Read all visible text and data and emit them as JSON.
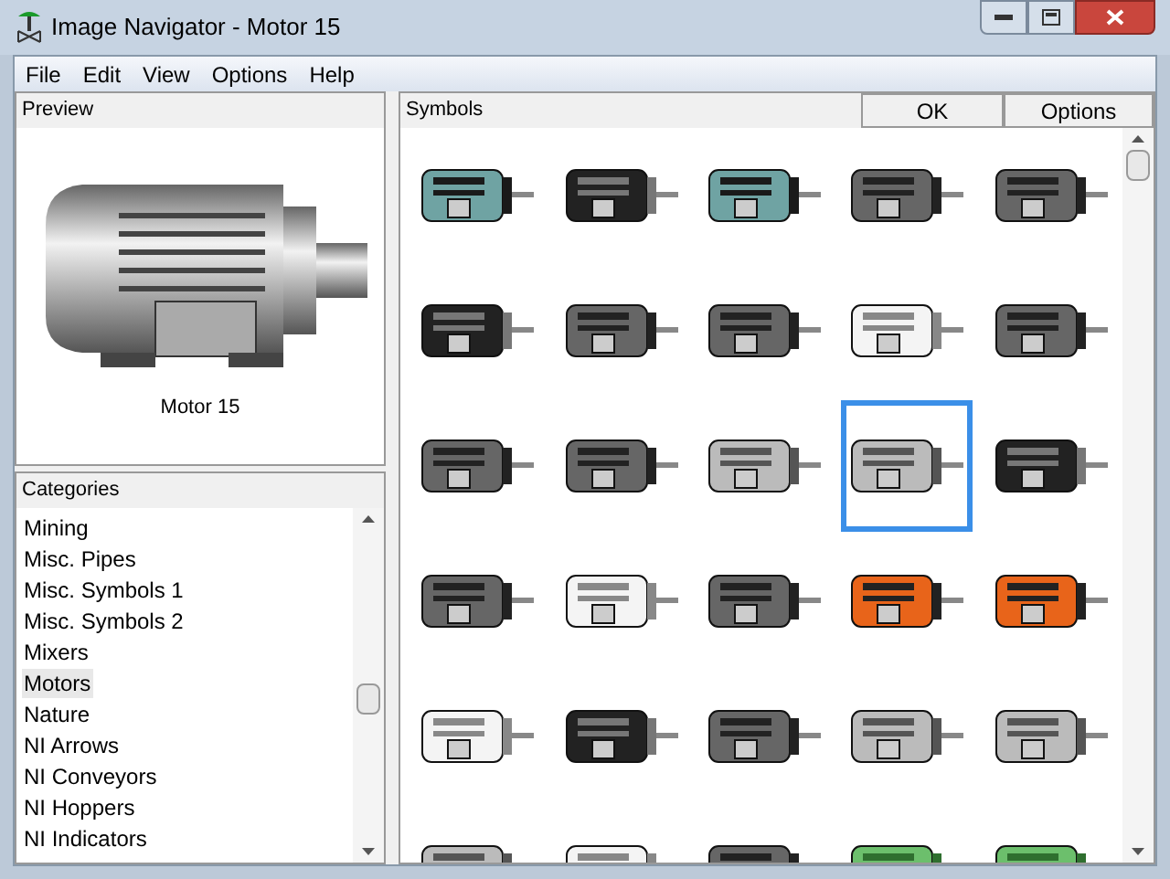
{
  "window": {
    "title": "Image Navigator - Motor 15"
  },
  "menu": [
    "File",
    "Edit",
    "View",
    "Options",
    "Help"
  ],
  "preview": {
    "header": "Preview",
    "caption": "Motor 15"
  },
  "categories": {
    "header": "Categories",
    "items": [
      {
        "label": "Mining",
        "selected": false
      },
      {
        "label": "Misc. Pipes",
        "selected": false
      },
      {
        "label": "Misc. Symbols 1",
        "selected": false
      },
      {
        "label": "Misc. Symbols 2",
        "selected": false
      },
      {
        "label": "Mixers",
        "selected": false
      },
      {
        "label": "Motors",
        "selected": true
      },
      {
        "label": "Nature",
        "selected": false
      },
      {
        "label": "NI Arrows",
        "selected": false
      },
      {
        "label": "NI Conveyors",
        "selected": false
      },
      {
        "label": "NI Hoppers",
        "selected": false
      },
      {
        "label": "NI Indicators",
        "selected": false
      }
    ]
  },
  "symbols": {
    "header": "Symbols",
    "buttons": [
      "OK",
      "Options"
    ],
    "items": [
      {
        "kind": "teal",
        "selected": false
      },
      {
        "kind": "black",
        "selected": false
      },
      {
        "kind": "teal",
        "selected": false
      },
      {
        "kind": "dark",
        "selected": false
      },
      {
        "kind": "dark",
        "selected": false
      },
      {
        "kind": "black",
        "selected": false
      },
      {
        "kind": "dark",
        "selected": false
      },
      {
        "kind": "dark",
        "selected": false
      },
      {
        "kind": "white",
        "selected": false
      },
      {
        "kind": "dark",
        "selected": false
      },
      {
        "kind": "dark",
        "selected": false
      },
      {
        "kind": "dark",
        "selected": false
      },
      {
        "kind": "silver",
        "selected": false
      },
      {
        "kind": "silver",
        "selected": true
      },
      {
        "kind": "black",
        "selected": false
      },
      {
        "kind": "dark",
        "selected": false
      },
      {
        "kind": "white",
        "selected": false
      },
      {
        "kind": "dark",
        "selected": false
      },
      {
        "kind": "orange",
        "selected": false
      },
      {
        "kind": "orange",
        "selected": false
      },
      {
        "kind": "white",
        "selected": false
      },
      {
        "kind": "black",
        "selected": false
      },
      {
        "kind": "dark",
        "selected": false
      },
      {
        "kind": "silver",
        "selected": false
      },
      {
        "kind": "silver",
        "selected": false
      },
      {
        "kind": "silver",
        "selected": false
      },
      {
        "kind": "white",
        "selected": false
      },
      {
        "kind": "dark",
        "selected": false
      },
      {
        "kind": "green",
        "selected": false
      },
      {
        "kind": "green",
        "selected": false
      }
    ]
  }
}
